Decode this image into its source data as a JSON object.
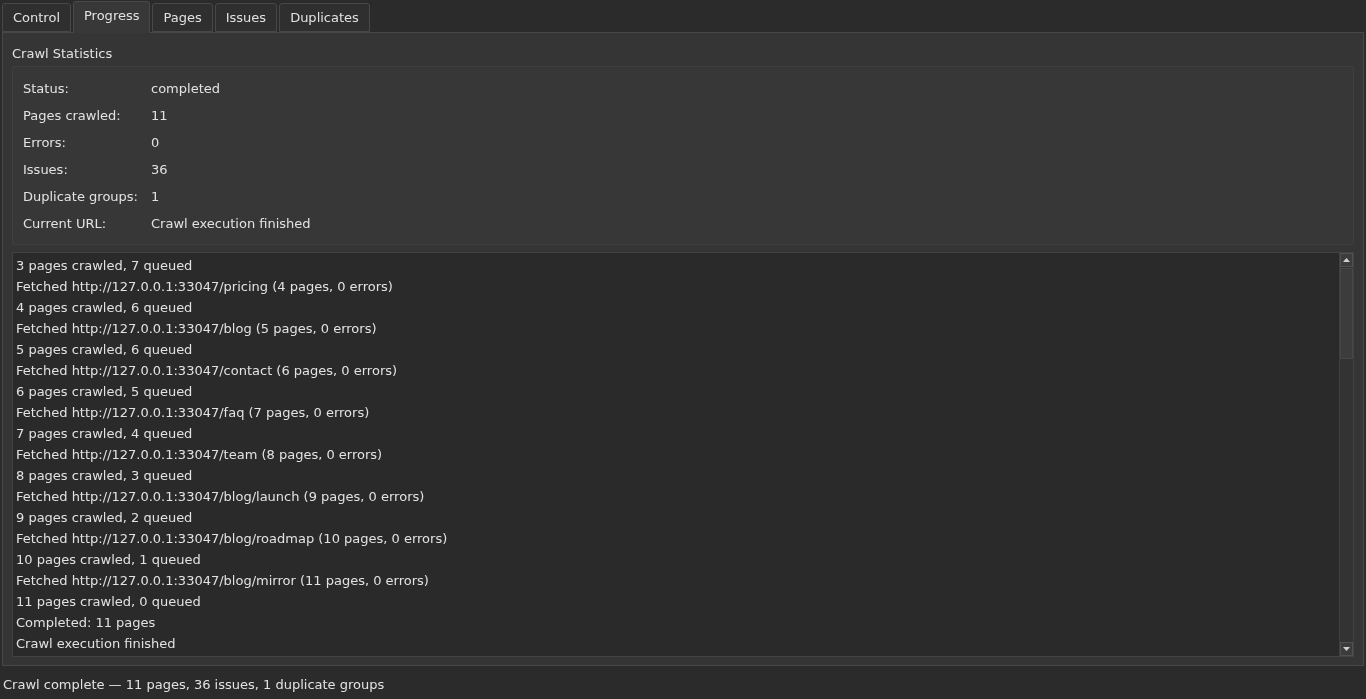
{
  "tabs": [
    {
      "label": "Control",
      "selected": false
    },
    {
      "label": "Progress",
      "selected": true
    },
    {
      "label": "Pages",
      "selected": false
    },
    {
      "label": "Issues",
      "selected": false
    },
    {
      "label": "Duplicates",
      "selected": false
    }
  ],
  "crawl_statistics": {
    "title": "Crawl Statistics",
    "fields": [
      {
        "label": "Status:",
        "value": "completed"
      },
      {
        "label": "Pages crawled:",
        "value": "11"
      },
      {
        "label": "Errors:",
        "value": "0"
      },
      {
        "label": "Issues:",
        "value": "36"
      },
      {
        "label": "Duplicate groups:",
        "value": "1"
      },
      {
        "label": "Current URL:",
        "value": "Crawl execution finished"
      }
    ]
  },
  "log": {
    "lines": [
      "3 pages crawled, 7 queued",
      "Fetched http://127.0.0.1:33047/pricing (4 pages, 0 errors)",
      "4 pages crawled, 6 queued",
      "Fetched http://127.0.0.1:33047/blog (5 pages, 0 errors)",
      "5 pages crawled, 6 queued",
      "Fetched http://127.0.0.1:33047/contact (6 pages, 0 errors)",
      "6 pages crawled, 5 queued",
      "Fetched http://127.0.0.1:33047/faq (7 pages, 0 errors)",
      "7 pages crawled, 4 queued",
      "Fetched http://127.0.0.1:33047/team (8 pages, 0 errors)",
      "8 pages crawled, 3 queued",
      "Fetched http://127.0.0.1:33047/blog/launch (9 pages, 0 errors)",
      "9 pages crawled, 2 queued",
      "Fetched http://127.0.0.1:33047/blog/roadmap (10 pages, 0 errors)",
      "10 pages crawled, 1 queued",
      "Fetched http://127.0.0.1:33047/blog/mirror (11 pages, 0 errors)",
      "11 pages crawled, 0 queued",
      "Completed: 11 pages",
      "Crawl execution finished"
    ]
  },
  "status_bar": {
    "text": "Crawl complete — 11 pages, 36 issues, 1 duplicate groups"
  }
}
